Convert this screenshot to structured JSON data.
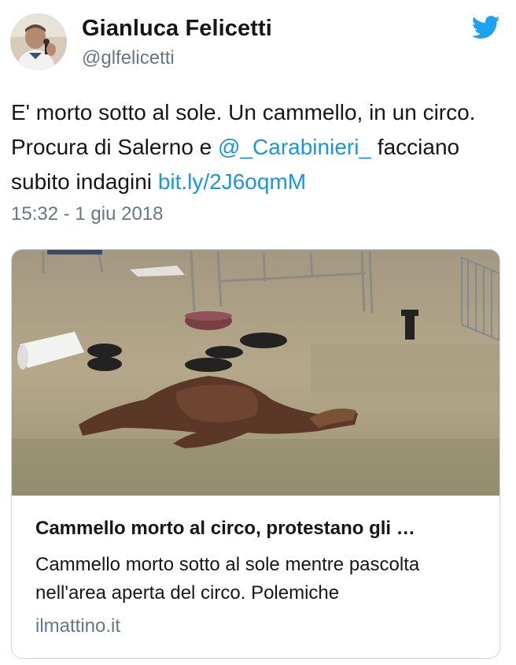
{
  "user": {
    "name": "Gianluca Felicetti",
    "handle": "@glfelicetti"
  },
  "tweet": {
    "text_1": "E' morto sotto al sole. Un cammello, in un circo. Procura di Salerno e ",
    "mention": "@_Carabinieri_",
    "text_2": " facciano subito indagini ",
    "link": "bit.ly/2J6oqmM",
    "timestamp": "15:32 - 1 giu 2018"
  },
  "card": {
    "title": "Cammello morto al circo, protestano gli …",
    "description": "Cammello morto sotto al sole mentre pascolta nell'area aperta del circo. Polemiche",
    "domain": "ilmattino.it"
  },
  "icons": {
    "brand": "twitter-bird-icon"
  },
  "colors": {
    "link": "#1b95e0",
    "secondary_text": "#657786",
    "brand": "#1da1f2"
  }
}
